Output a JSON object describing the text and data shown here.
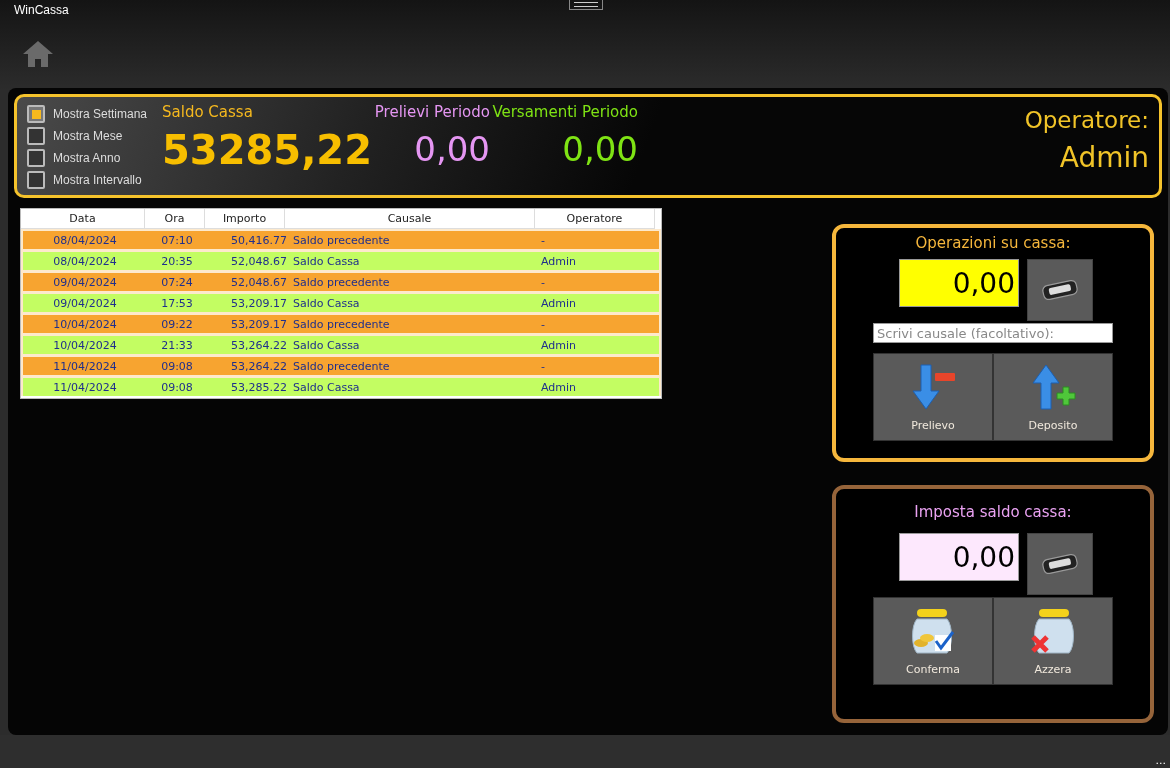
{
  "window": {
    "title": "WinCassa"
  },
  "filters": [
    {
      "label": "Mostra Settimana",
      "checked": true
    },
    {
      "label": "Mostra Mese",
      "checked": false
    },
    {
      "label": "Mostra Anno",
      "checked": false
    },
    {
      "label": "Mostra Intervallo",
      "checked": false
    }
  ],
  "summary": {
    "saldo_label": "Saldo Cassa",
    "saldo_value": "53285,22",
    "prelievi_label": "Prelievi Periodo",
    "prelievi_value": "0,00",
    "versamenti_label": "Versamenti Periodo",
    "versamenti_value": "0,00",
    "operator_label": "Operatore:",
    "operator_value": "Admin"
  },
  "table": {
    "columns": [
      "Data",
      "Ora",
      "Importo",
      "Causale",
      "Operatore"
    ],
    "rows": [
      {
        "kind": "previous",
        "cells": [
          "08/04/2024",
          "07:10",
          "50,416.77",
          "Saldo precedente",
          "-"
        ]
      },
      {
        "kind": "balance",
        "cells": [
          "08/04/2024",
          "20:35",
          "52,048.67",
          "Saldo Cassa",
          "Admin"
        ]
      },
      {
        "kind": "previous",
        "cells": [
          "09/04/2024",
          "07:24",
          "52,048.67",
          "Saldo precedente",
          "-"
        ]
      },
      {
        "kind": "balance",
        "cells": [
          "09/04/2024",
          "17:53",
          "53,209.17",
          "Saldo Cassa",
          "Admin"
        ]
      },
      {
        "kind": "previous",
        "cells": [
          "10/04/2024",
          "09:22",
          "53,209.17",
          "Saldo precedente",
          "-"
        ]
      },
      {
        "kind": "balance",
        "cells": [
          "10/04/2024",
          "21:33",
          "53,264.22",
          "Saldo Cassa",
          "Admin"
        ]
      },
      {
        "kind": "previous",
        "cells": [
          "11/04/2024",
          "09:08",
          "53,264.22",
          "Saldo precedente",
          "-"
        ]
      },
      {
        "kind": "balance",
        "cells": [
          "11/04/2024",
          "09:08",
          "53,285.22",
          "Saldo Cassa",
          "Admin"
        ]
      }
    ]
  },
  "operations": {
    "title": "Operazioni su cassa:",
    "amount": "0,00",
    "reason_placeholder": "Scrivi causale (facoltativo):",
    "buttons": [
      {
        "kind": "withdraw",
        "label": "Prelievo"
      },
      {
        "kind": "deposit",
        "label": "Deposito"
      }
    ]
  },
  "set_balance": {
    "title": "Imposta saldo cassa:",
    "amount": "0,00",
    "buttons": [
      {
        "kind": "confirm",
        "label": "Conferma"
      },
      {
        "kind": "reset",
        "label": "Azzera"
      }
    ]
  },
  "status_bar": {
    "more": "..."
  }
}
